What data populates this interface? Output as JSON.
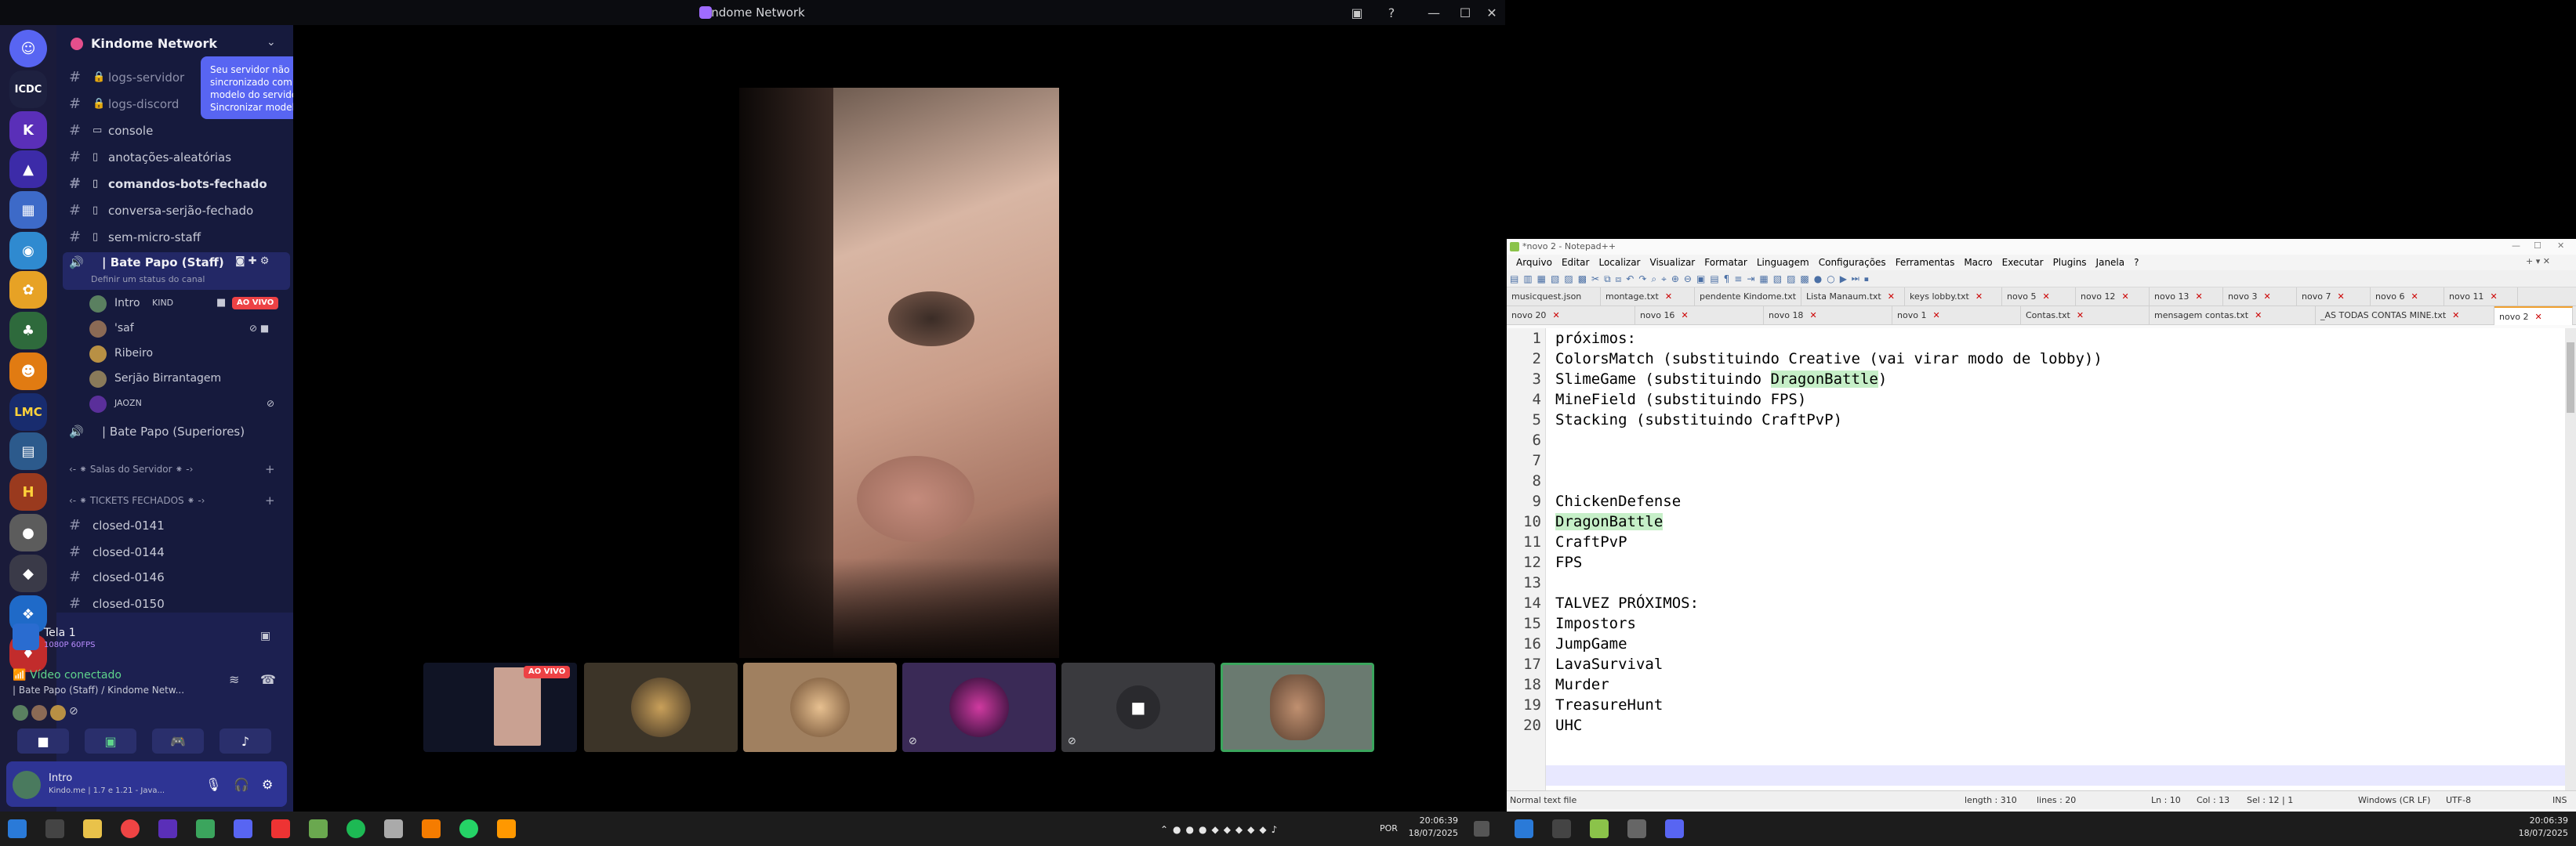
{
  "discord": {
    "app_title": "Kindome Network",
    "server_name": "Kindome Network",
    "tooltip": "Seu servidor não está sincronizado com o modelo do servidor. Sincronizar modelo?",
    "channels": [
      {
        "name": "logs-servidor",
        "icon": "lock-icon"
      },
      {
        "name": "logs-discord",
        "icon": "lock-icon"
      },
      {
        "name": "console",
        "icon": "monitor-icon"
      },
      {
        "name": "anotações-aleatórias",
        "icon": "page-icon"
      },
      {
        "name": "comandos-bots-fechado",
        "icon": "page-icon"
      },
      {
        "name": "conversa-serjão-fechado",
        "icon": "page-icon"
      },
      {
        "name": "sem-micro-staff",
        "icon": "page-icon"
      }
    ],
    "voice_channel": "| Bate Papo (Staff)",
    "status_hint": "Definir um status do canal",
    "voice_users": [
      {
        "name": "Intro",
        "tag": "KIND",
        "badge": "AO VIVO"
      },
      {
        "name": "'saf"
      },
      {
        "name": "Ribeiro"
      },
      {
        "name": "Serjão Birrantagem"
      },
      {
        "name": "JAOZN"
      }
    ],
    "voice_channel_2": "| Bate Papo (Superiores)",
    "category_1": "‹- ⁕ Salas do Servidor ⁕ -›",
    "category_2": "‹- ⁕ TICKETS FECHADOS ⁕ -›",
    "tickets": [
      "closed-0141",
      "closed-0144",
      "closed-0146",
      "closed-0150"
    ],
    "stream_title": "Tela 1",
    "stream_quality": "1080P 60FPS",
    "video_status": "Vídeo conectado",
    "video_channel": "| Bate Papo (Staff) / Kindome Netw...",
    "user_name": "Intro",
    "user_status": "Kindo.me | 1.7 e 1.21 - Java...",
    "live_badge": "AO VIVO",
    "guild_labels": [
      "ICDC",
      "LMC"
    ],
    "colors": {
      "accent": "#5865f2",
      "live": "#ed4245",
      "panel": "#1c2050"
    }
  },
  "notepad": {
    "title": "*novo 2 - Notepad++",
    "menu": [
      "Arquivo",
      "Editar",
      "Localizar",
      "Visualizar",
      "Formatar",
      "Linguagem",
      "Configurações",
      "Ferramentas",
      "Macro",
      "Executar",
      "Plugins",
      "Janela",
      "?"
    ],
    "tabs_row1": [
      "musicquest.json",
      "montage.txt",
      "pendente Kindome.txt",
      "Lista Manaum.txt",
      "keys lobby.txt",
      "novo 5",
      "novo 12",
      "novo 13",
      "novo 3",
      "novo 7",
      "novo 6",
      "novo 11"
    ],
    "tabs_row2": [
      "novo 20",
      "novo 16",
      "novo 18",
      "novo 1",
      "Contas.txt",
      "mensagem contas.txt",
      "_AS TODAS CONTAS MINE.txt",
      "novo 2"
    ],
    "lines": [
      "próximos:",
      "ColorsMatch (substituindo Creative (vai virar modo de lobby))",
      "SlimeGame (substituindo DragonBattle)",
      "MineField (substituindo FPS)",
      "Stacking (substituindo CraftPvP)",
      "",
      "",
      "",
      "ChickenDefense",
      "DragonBattle",
      "CraftPvP",
      "FPS",
      "",
      "TALVEZ PRÓXIMOS:",
      "Impostors",
      "JumpGame",
      "LavaSurvival",
      "Murder",
      "TreasureHunt",
      "UHC"
    ],
    "line3_prefix": "SlimeGame (substituindo ",
    "line3_highlight": "DragonBattle",
    "line3_suffix": ")",
    "status": {
      "type": "Normal text file",
      "length": "length : 310",
      "lines": "lines : 20",
      "pos": "Ln : 10",
      "col": "Col : 13",
      "sel": "Sel : 12 | 1",
      "eol": "Windows (CR LF)",
      "enc": "UTF-8",
      "ins": "INS"
    }
  },
  "taskbar": {
    "time_left": "20:06:39",
    "date_left": "18/07/2025",
    "lang": "POR",
    "time_right": "20:06:39",
    "date_right": "18/07/2025"
  }
}
